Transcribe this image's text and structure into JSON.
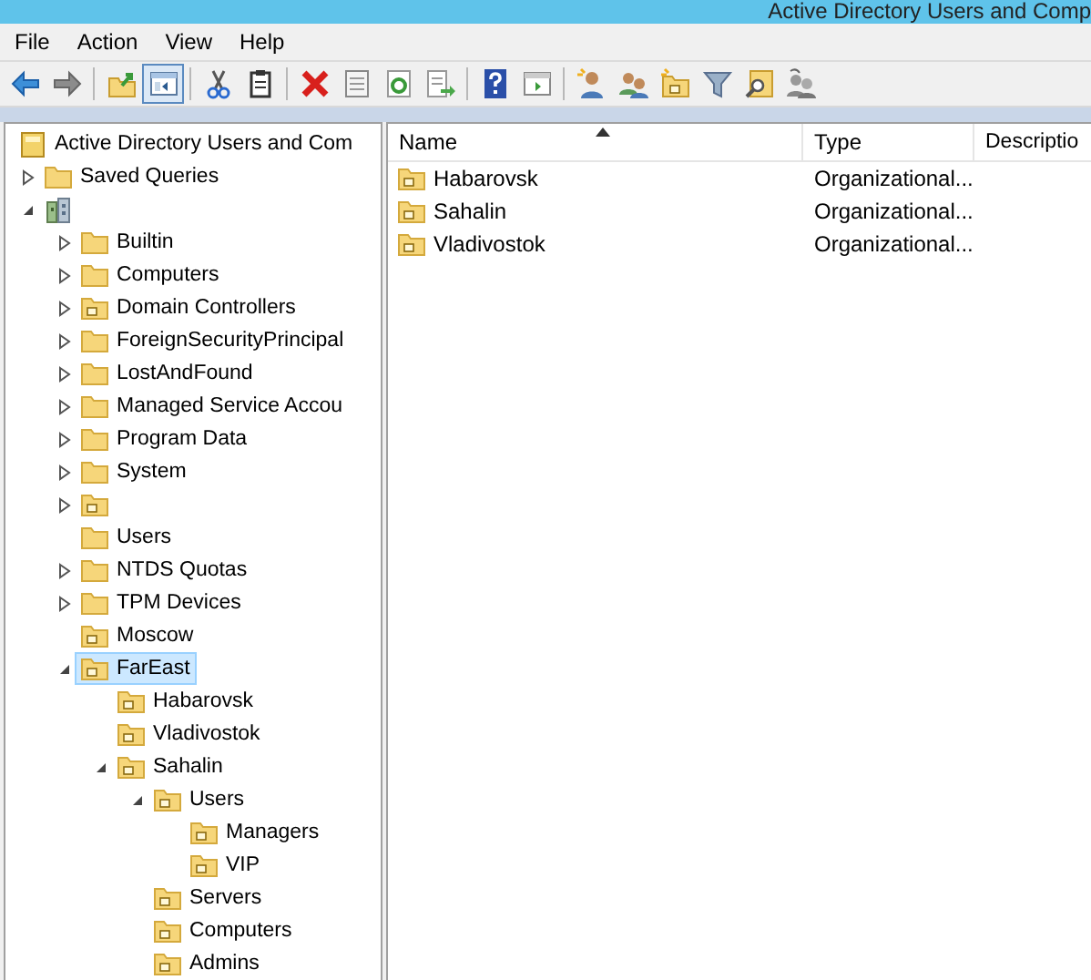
{
  "window": {
    "title": "Active Directory Users and Comp"
  },
  "menu": [
    "File",
    "Action",
    "View",
    "Help"
  ],
  "toolbar": [
    [
      {
        "kind": "back",
        "pressed": false
      },
      {
        "kind": "forward",
        "pressed": false
      }
    ],
    [
      {
        "kind": "up",
        "pressed": false
      },
      {
        "kind": "tree",
        "pressed": true
      }
    ],
    [
      {
        "kind": "cut",
        "pressed": false
      },
      {
        "kind": "paste",
        "pressed": false
      }
    ],
    [
      {
        "kind": "delete",
        "pressed": false
      },
      {
        "kind": "properties",
        "pressed": false
      },
      {
        "kind": "refresh",
        "pressed": false
      },
      {
        "kind": "export",
        "pressed": false
      }
    ],
    [
      {
        "kind": "help",
        "pressed": false
      },
      {
        "kind": "actionpane",
        "pressed": false
      }
    ],
    [
      {
        "kind": "newuser",
        "pressed": false
      },
      {
        "kind": "newgroup",
        "pressed": false
      },
      {
        "kind": "newou",
        "pressed": false
      },
      {
        "kind": "filter",
        "pressed": false
      },
      {
        "kind": "find",
        "pressed": false
      },
      {
        "kind": "delegate",
        "pressed": false
      }
    ]
  ],
  "tree": [
    {
      "label": "Active Directory Users and Com",
      "kind": "root",
      "selected": false,
      "children": [
        {
          "label": "Saved Queries",
          "kind": "folder",
          "expanded": false,
          "selected": false
        },
        {
          "kind": "domain",
          "expanded": true,
          "selected": false,
          "children": [
            {
              "label": "Builtin",
              "kind": "folder",
              "expanded": false,
              "selected": false
            },
            {
              "label": "Computers",
              "kind": "folder",
              "expanded": false,
              "selected": false
            },
            {
              "label": "Domain Controllers",
              "kind": "ou",
              "expanded": false,
              "selected": false
            },
            {
              "label": "ForeignSecurityPrincipal",
              "kind": "folder",
              "expanded": false,
              "selected": false
            },
            {
              "label": "LostAndFound",
              "kind": "folder",
              "expanded": false,
              "selected": false
            },
            {
              "label": "Managed Service Accou",
              "kind": "folder",
              "expanded": false,
              "selected": false
            },
            {
              "label": "Program Data",
              "kind": "folder",
              "expanded": false,
              "selected": false
            },
            {
              "label": "System",
              "kind": "folder",
              "expanded": false,
              "selected": false
            },
            {
              "kind": "ou",
              "expanded": false,
              "selected": false
            },
            {
              "label": "Users",
              "kind": "folder",
              "selected": false
            },
            {
              "label": "NTDS Quotas",
              "kind": "folder",
              "expanded": false,
              "selected": false
            },
            {
              "label": "TPM Devices",
              "kind": "folder",
              "expanded": false,
              "selected": false
            },
            {
              "label": "Moscow",
              "kind": "ou",
              "selected": false
            },
            {
              "label": "FarEast",
              "kind": "ou",
              "expanded": true,
              "selected": true,
              "children": [
                {
                  "label": "Habarovsk",
                  "kind": "ou",
                  "selected": false
                },
                {
                  "label": "Vladivostok",
                  "kind": "ou",
                  "selected": false
                },
                {
                  "label": "Sahalin",
                  "kind": "ou",
                  "expanded": true,
                  "selected": false,
                  "children": [
                    {
                      "label": "Users",
                      "kind": "ou",
                      "expanded": true,
                      "selected": false,
                      "children": [
                        {
                          "label": "Managers",
                          "kind": "ou",
                          "selected": false
                        },
                        {
                          "label": "VIP",
                          "kind": "ou",
                          "selected": false
                        }
                      ]
                    },
                    {
                      "label": "Servers",
                      "kind": "ou",
                      "selected": false
                    },
                    {
                      "label": "Computers",
                      "kind": "ou",
                      "selected": false
                    },
                    {
                      "label": "Admins",
                      "kind": "ou",
                      "selected": false
                    }
                  ]
                }
              ]
            }
          ]
        }
      ]
    }
  ],
  "list": {
    "columns": [
      {
        "label": "Name",
        "sorted": true
      },
      {
        "label": "Type",
        "sorted": false
      },
      {
        "label": "Descriptio",
        "sorted": false
      }
    ],
    "rows": [
      {
        "kind": "ou",
        "name": "Habarovsk",
        "type": "Organizational..."
      },
      {
        "kind": "ou",
        "name": "Sahalin",
        "type": "Organizational..."
      },
      {
        "kind": "ou",
        "name": "Vladivostok",
        "type": "Organizational..."
      }
    ]
  }
}
